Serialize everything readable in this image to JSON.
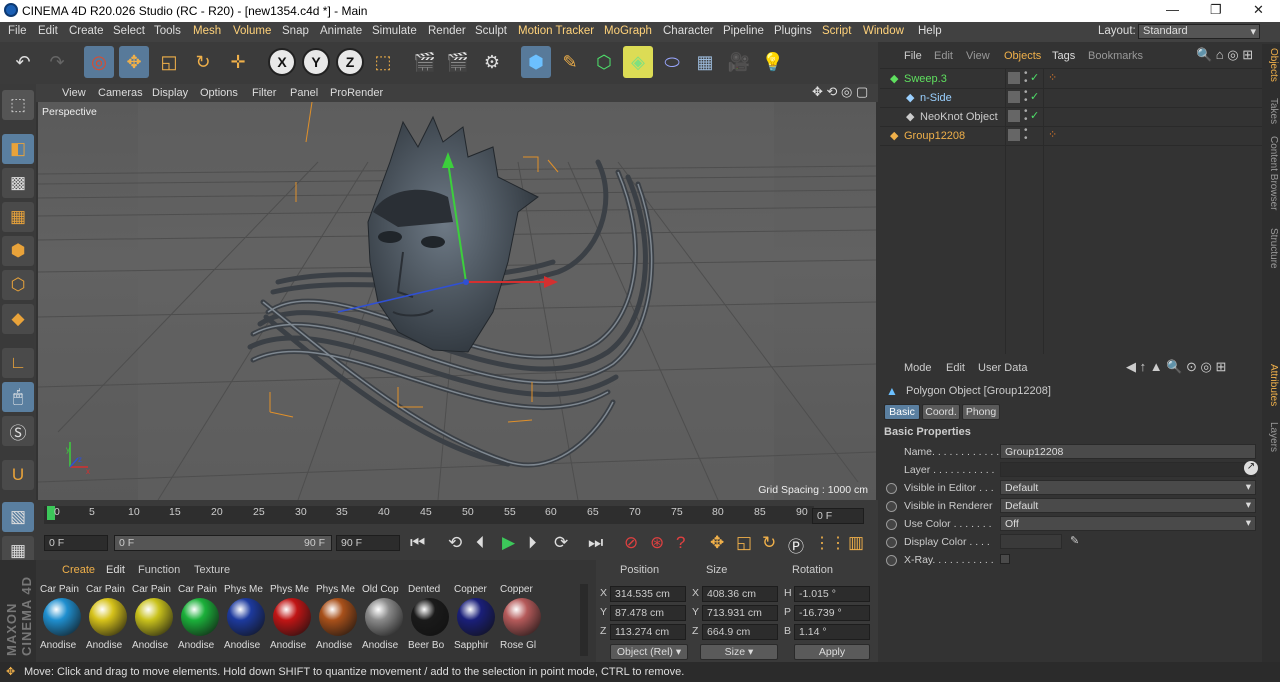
{
  "title": "CINEMA 4D R20.026 Studio (RC - R20) - [new1354.c4d *] - Main",
  "window_controls": [
    "—",
    "❐",
    "✕"
  ],
  "menu": [
    "File",
    "Edit",
    "Create",
    "Select",
    "Tools",
    "Mesh",
    "Volume",
    "Snap",
    "Animate",
    "Simulate",
    "Render",
    "Sculpt",
    "Motion Tracker",
    "MoGraph",
    "Character",
    "Pipeline",
    "Plugins",
    "Script",
    "Window",
    "Help"
  ],
  "layout": {
    "label": "Layout:",
    "value": "Standard"
  },
  "viewport": {
    "menu": [
      "View",
      "Cameras",
      "Display",
      "Options",
      "Filter",
      "Panel",
      "ProRender"
    ],
    "label": "Perspective",
    "grid_spacing": "Grid Spacing : 1000 cm"
  },
  "timeline": {
    "ticks": [
      "0",
      "5",
      "10",
      "15",
      "20",
      "25",
      "30",
      "35",
      "40",
      "45",
      "50",
      "55",
      "60",
      "65",
      "70",
      "75",
      "80",
      "85",
      "90"
    ],
    "current_frame": "0 F"
  },
  "playbar": {
    "start": "0 F",
    "range_start": "0 F",
    "range_end": "90 F",
    "end": "90 F"
  },
  "materials": {
    "menu": [
      "Create",
      "Edit",
      "Function",
      "Texture"
    ],
    "items": [
      {
        "top": "Car Pain",
        "bottom": "Anodise",
        "color": "#1f8fcf"
      },
      {
        "top": "Car Pain",
        "bottom": "Anodise",
        "color": "#d6c21a"
      },
      {
        "top": "Car Pain",
        "bottom": "Anodise",
        "color": "#c9c21c"
      },
      {
        "top": "Car Pain",
        "bottom": "Anodise",
        "color": "#1bb03a"
      },
      {
        "top": "Phys Me",
        "bottom": "Anodise",
        "color": "#1d3a9e"
      },
      {
        "top": "Phys Me",
        "bottom": "Anodise",
        "color": "#c01515"
      },
      {
        "top": "Phys Me",
        "bottom": "Anodise",
        "color": "#a8501a"
      },
      {
        "top": "Old Cop",
        "bottom": "Anodise",
        "color": "#8a8a8a"
      },
      {
        "top": "Dented",
        "bottom": "Beer Bo",
        "color": "#1a1a1a"
      },
      {
        "top": "Copper",
        "bottom": "Sapphir",
        "color": "#1a1f7a"
      },
      {
        "top": "Copper",
        "bottom": "Rose Gl",
        "color": "#b55a5a"
      }
    ]
  },
  "coords": {
    "headers": [
      "Position",
      "Size",
      "Rotation"
    ],
    "rows": [
      {
        "pl": "X",
        "pv": "314.535 cm",
        "sl": "X",
        "sv": "408.36 cm",
        "rl": "H",
        "rv": "-1.015 °"
      },
      {
        "pl": "Y",
        "pv": "87.478 cm",
        "sl": "Y",
        "sv": "713.931 cm",
        "rl": "P",
        "rv": "-16.739 °"
      },
      {
        "pl": "Z",
        "pv": "113.274 cm",
        "sl": "Z",
        "sv": "664.9 cm",
        "rl": "B",
        "rv": "1.14 °"
      }
    ],
    "mode": "Object (Rel)",
    "size_mode": "Size",
    "apply": "Apply"
  },
  "objects": {
    "menu": [
      "File",
      "Edit",
      "View",
      "Objects",
      "Tags",
      "Bookmarks"
    ],
    "items": [
      {
        "name": "Sweep.3",
        "color": "#5fe05f"
      },
      {
        "name": "n-Side",
        "color": "#9ad0ff"
      },
      {
        "name": "NeoKnot Object",
        "color": "#ccc"
      },
      {
        "name": "Group12208",
        "color": "#f0b04a"
      }
    ]
  },
  "attributes": {
    "menu": [
      "Mode",
      "Edit",
      "User Data"
    ],
    "object_title": "Polygon Object [Group12208]",
    "tabs": [
      "Basic",
      "Coord.",
      "Phong"
    ],
    "section": "Basic Properties",
    "rows": [
      {
        "label": "Name. . . . . . . . . . . .",
        "value": "Group12208"
      },
      {
        "label": "Layer . . . . . . . . . . .",
        "value": ""
      },
      {
        "label": "Visible in Editor . . .",
        "value": "Default"
      },
      {
        "label": "Visible in Renderer",
        "value": "Default"
      },
      {
        "label": "Use Color . . . . . . .",
        "value": "Off"
      },
      {
        "label": "Display Color . . . .",
        "value": ""
      },
      {
        "label": "X-Ray. . . . . . . . . . .",
        "value": ""
      }
    ]
  },
  "side_tabs": [
    "Objects",
    "Takes",
    "Content Browser",
    "Structure",
    "Attributes",
    "Layers"
  ],
  "brand": "MAXON CINEMA 4D",
  "status": "Move: Click and drag to move elements. Hold down SHIFT to quantize movement / add to the selection in point mode, CTRL to remove."
}
